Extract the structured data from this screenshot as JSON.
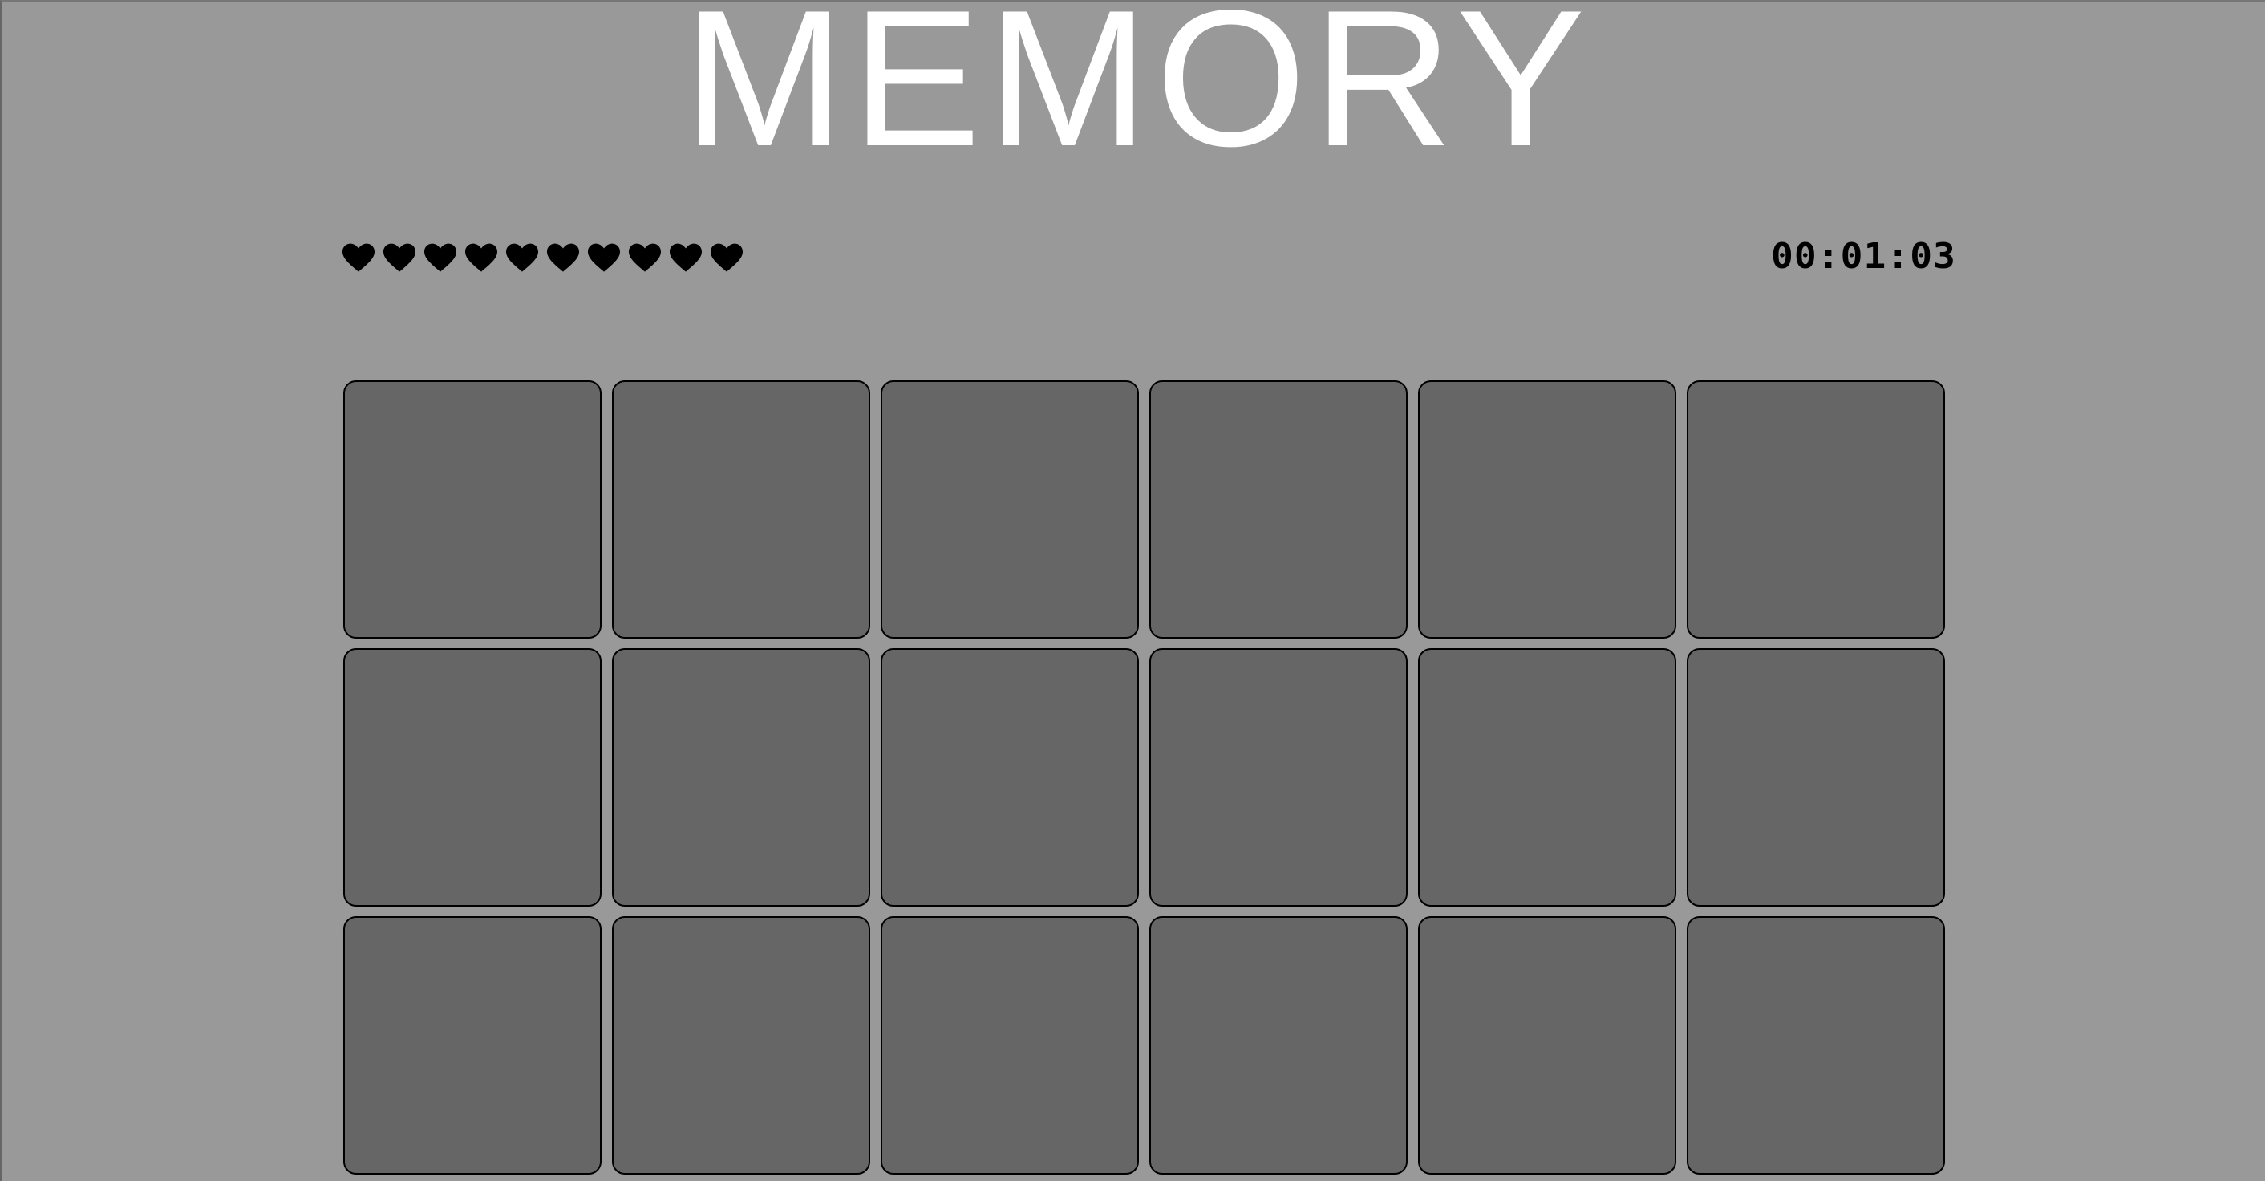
{
  "title": "MEMORY",
  "lives": {
    "count": 10,
    "icon": "heart-icon",
    "color": "#000000"
  },
  "timer": "00:01:03",
  "board": {
    "rows": 3,
    "columns": 6,
    "card_state": "face-down",
    "card_color": "#666666"
  },
  "colors": {
    "background": "#999999",
    "logo": "#ffffff"
  }
}
